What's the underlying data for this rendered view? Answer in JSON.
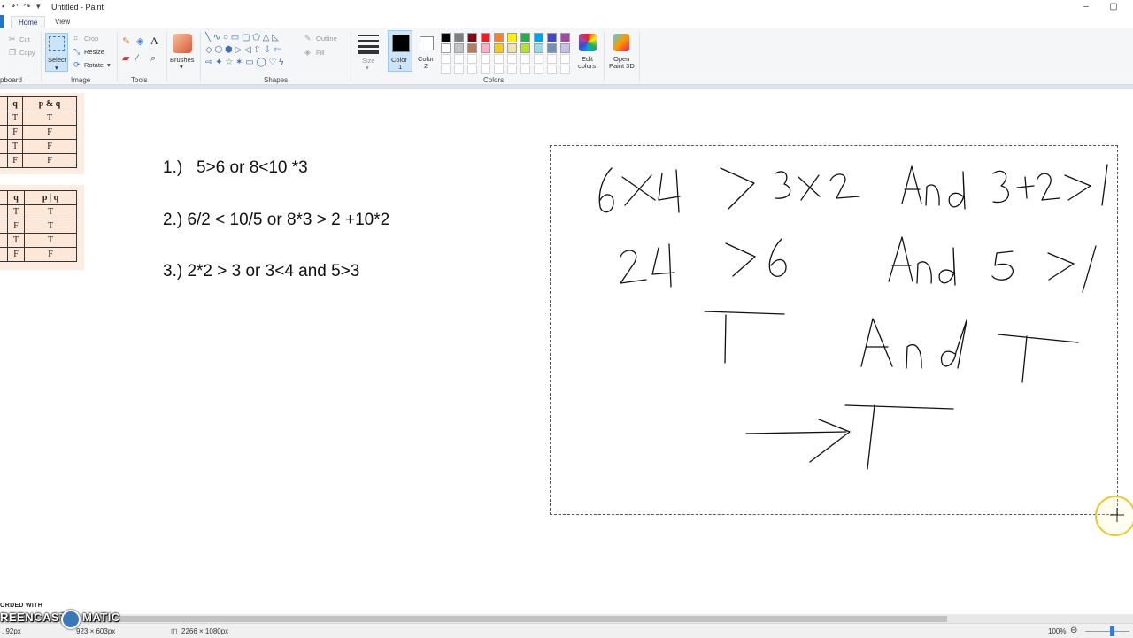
{
  "window": {
    "title": "Untitled - Paint",
    "minimize": "–",
    "maximize": "▢"
  },
  "quick_access": {
    "save": "▪",
    "undo": "↶",
    "redo": "↷",
    "dropdown": "▾"
  },
  "tabs": {
    "home": "Home",
    "view": "View"
  },
  "ribbon": {
    "clipboard": {
      "cut": "Cut",
      "copy": "Copy",
      "label": "pboard"
    },
    "image": {
      "select": "Select",
      "crop": "Crop",
      "resize": "Resize",
      "rotate": "Rotate",
      "label": "Image"
    },
    "tools": {
      "label": "Tools"
    },
    "brushes": {
      "label": "Brushes"
    },
    "shapes": {
      "outline": "Outline",
      "fill": "Fill",
      "label": "Shapes"
    },
    "size": {
      "label": "Size"
    },
    "colors": {
      "color1": "Color",
      "color1_num": "1",
      "color2": "Color",
      "color2_num": "2",
      "label": "Colors",
      "edit": "Edit",
      "edit2": "colors",
      "palette_row1": [
        "#000000",
        "#7f7f7f",
        "#880015",
        "#ed1c24",
        "#ff7f27",
        "#fff200",
        "#22b14c",
        "#00a2e8",
        "#3f48cc",
        "#a349a4"
      ],
      "palette_row2": [
        "#ffffff",
        "#c3c3c3",
        "#b97a57",
        "#ffaec9",
        "#ffc90e",
        "#efe4b0",
        "#b5e61d",
        "#99d9ea",
        "#7092be",
        "#c8bfe7"
      ]
    },
    "paint3d": {
      "line1": "Open",
      "line2": "Paint 3D"
    }
  },
  "table1": {
    "headers": [
      "q",
      "p & q"
    ],
    "rows": [
      [
        "T",
        "T"
      ],
      [
        "F",
        "F"
      ],
      [
        "T",
        "F"
      ],
      [
        "F",
        "F"
      ]
    ]
  },
  "table2": {
    "headers": [
      "q",
      "p | q"
    ],
    "rows": [
      [
        "T",
        "T"
      ],
      [
        "F",
        "T"
      ],
      [
        "T",
        "T"
      ],
      [
        "F",
        "F"
      ]
    ]
  },
  "expressions": {
    "e1": "1.)   5>6 or 8<10 *3",
    "e2": "2.) 6/2 < 10/5 or 8*3 > 2 +10*2",
    "e3": "3.) 2*2 > 3 or 3<4 and 5>3"
  },
  "status": {
    "pos": ", 92px",
    "selection": "923 × 603px",
    "canvas": "2266 × 1080px",
    "zoom": "100%",
    "zoom_minus": "⊖"
  },
  "watermark": {
    "top": "ORDED WITH",
    "main_left": "REENCAST",
    "main_right": "MATIC"
  }
}
